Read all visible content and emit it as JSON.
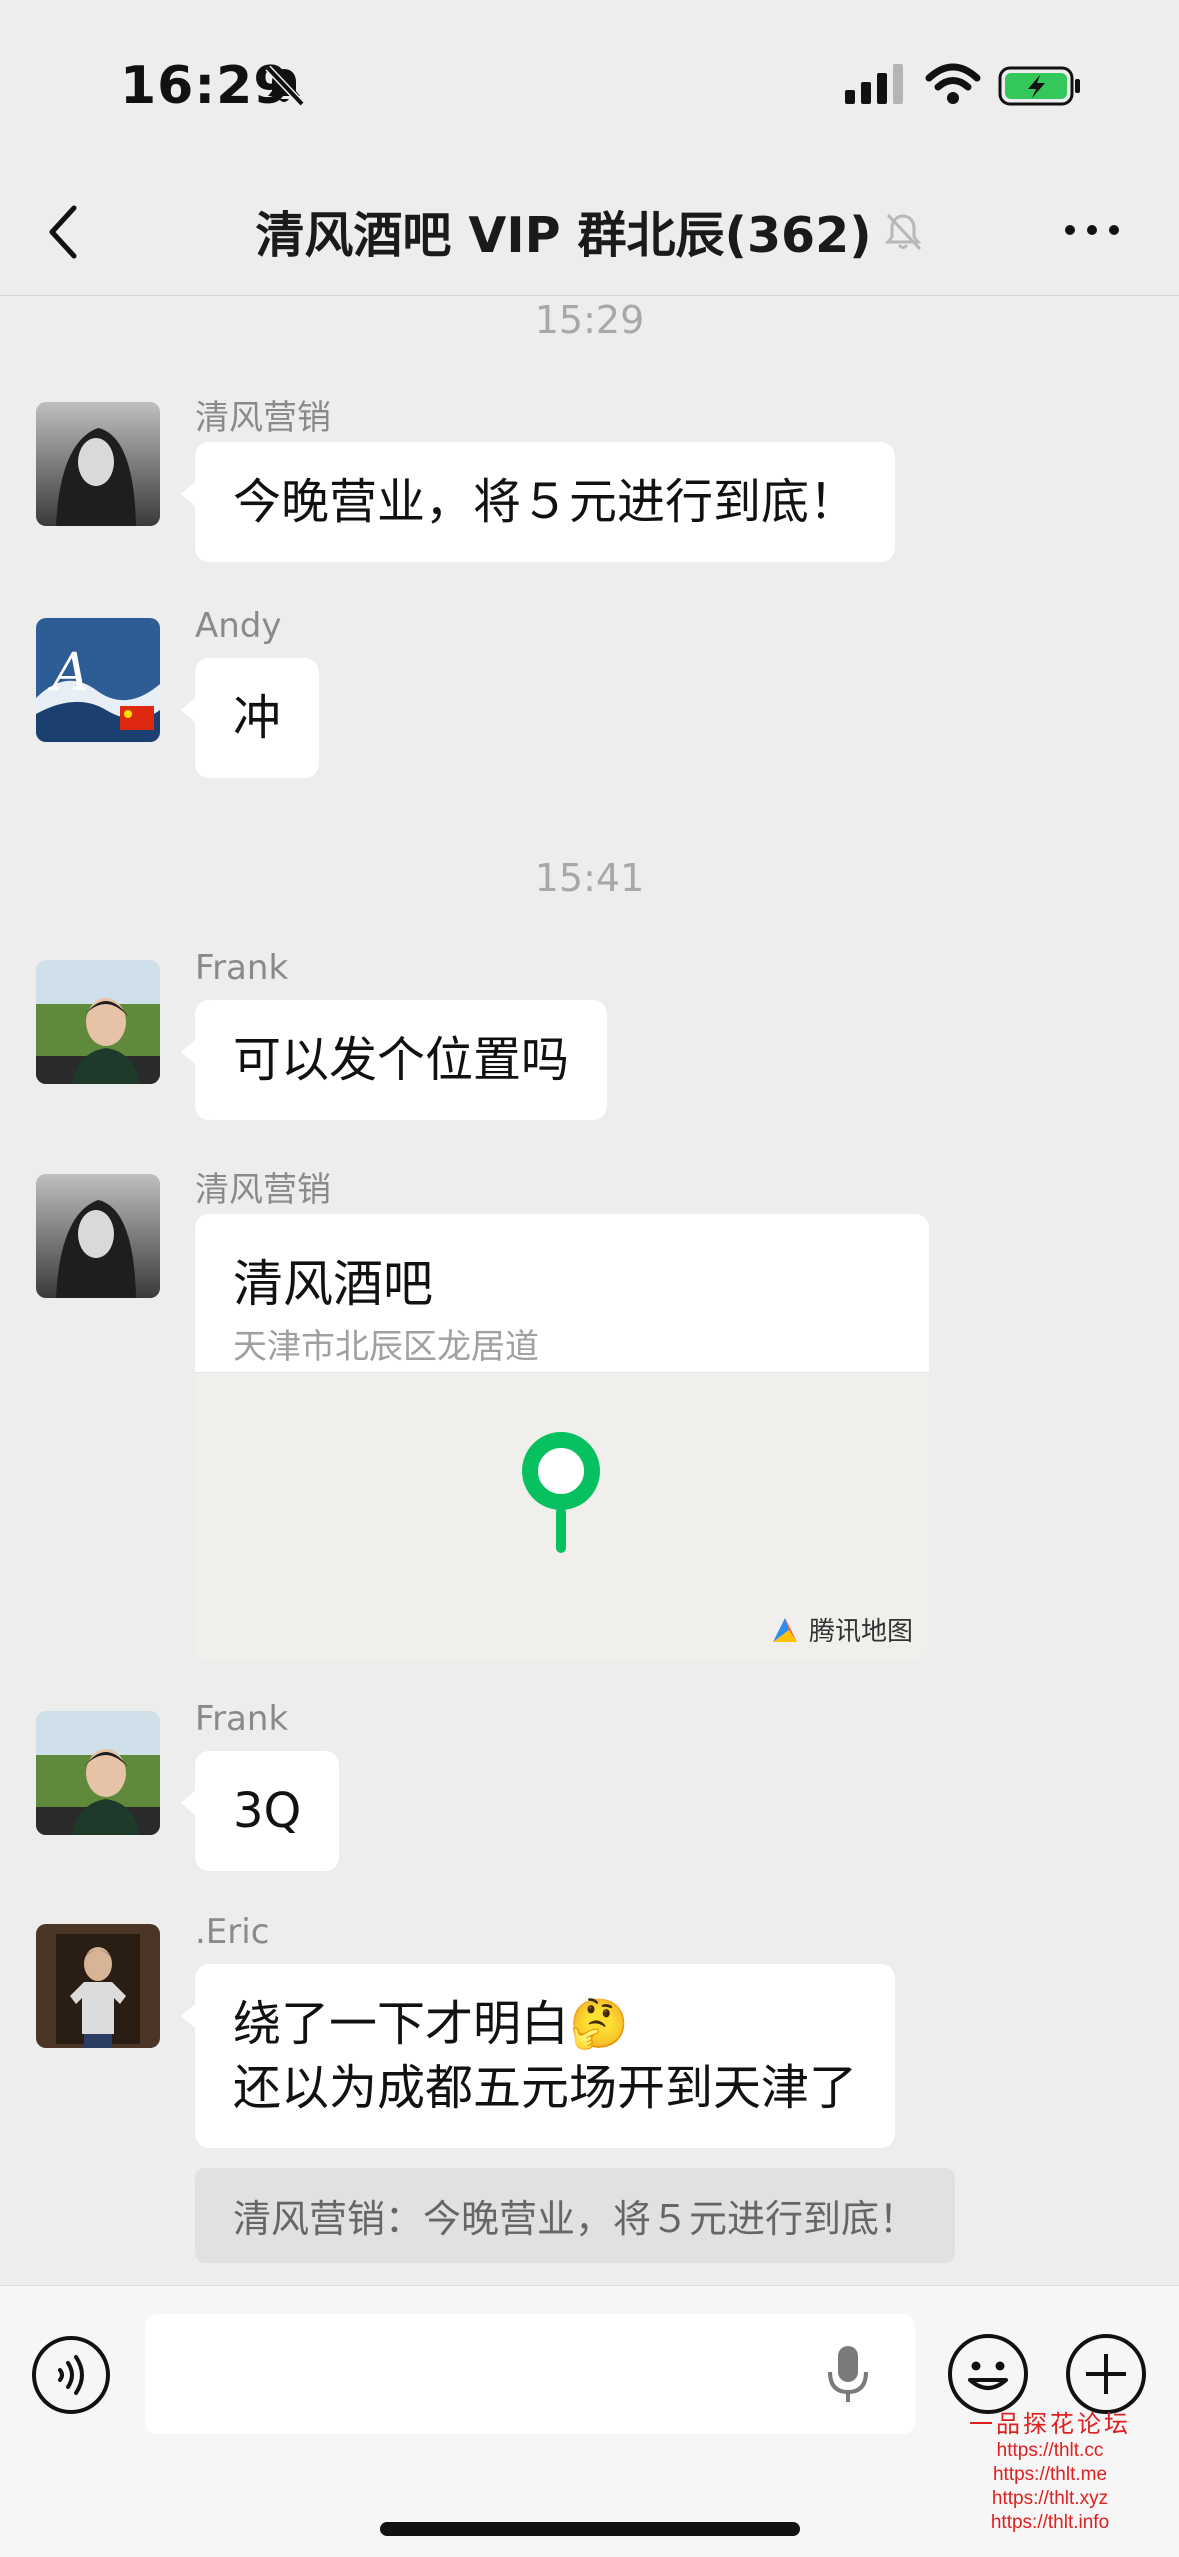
{
  "status_bar": {
    "time": "16:29"
  },
  "nav": {
    "title": "清风酒吧 VIP 群北辰(362)"
  },
  "timestamps": [
    "15:29",
    "15:41"
  ],
  "messages": [
    {
      "sender": "清风营销",
      "text": "今晚营业，将５元进行到底！"
    },
    {
      "sender": "Andy",
      "text": "冲"
    },
    {
      "sender": "Frank",
      "text": "可以发个位置吗"
    },
    {
      "sender": "清风营销",
      "location": {
        "name": "清风酒吧",
        "address": "天津市北辰区龙居道",
        "provider": "腾讯地图"
      }
    },
    {
      "sender": "Frank",
      "text": "3Q"
    },
    {
      "sender": ".Eric",
      "line1": "绕了一下才明白🤔",
      "line2": "还以为成都五元场开到天津了",
      "quote": "清风营销：今晚营业，将５元进行到底！"
    }
  ],
  "input": {
    "value": "",
    "placeholder": ""
  },
  "watermark": {
    "title": "一品探花论坛",
    "links": [
      "https://thlt.cc",
      "https://thlt.me",
      "https://thlt.xyz",
      "https://thlt.info"
    ]
  }
}
